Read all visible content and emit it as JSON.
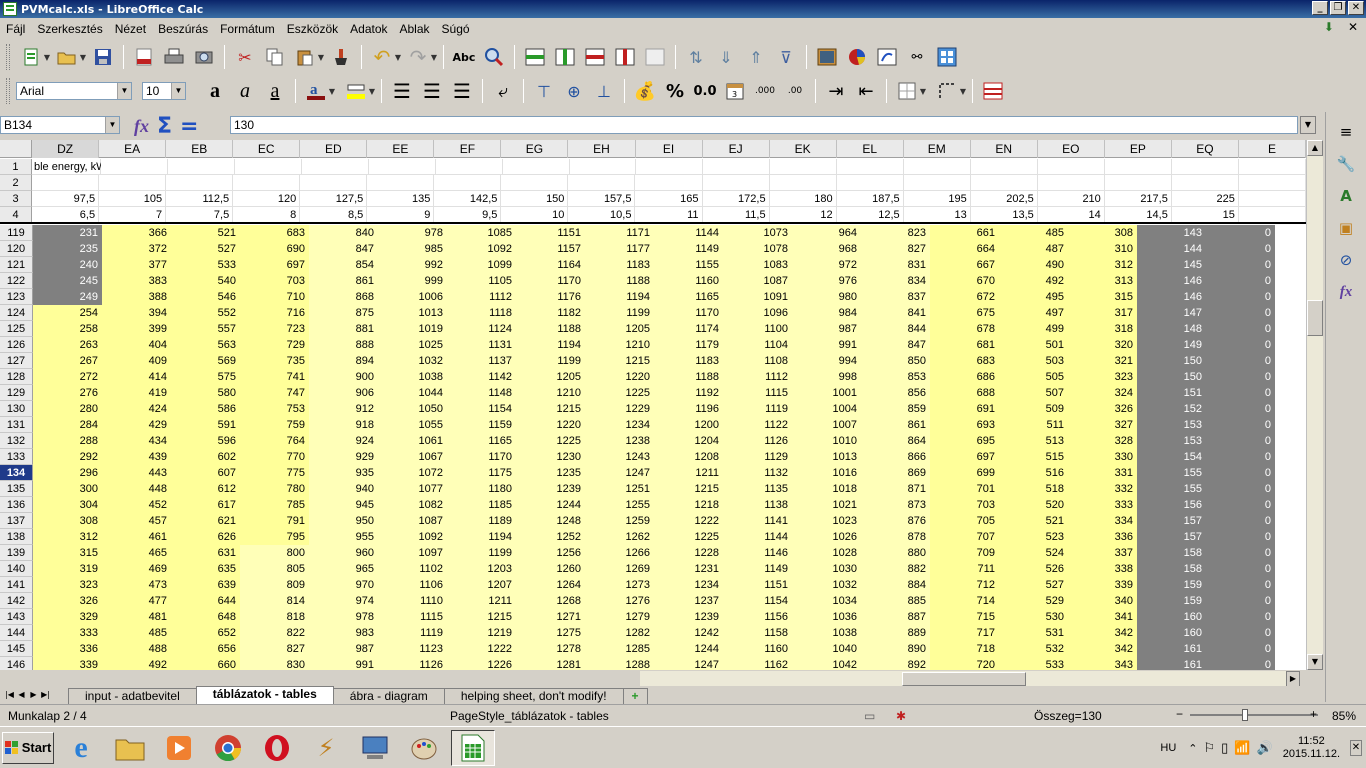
{
  "window": {
    "title": "PVMcalc.xls - LibreOffice Calc"
  },
  "menu": [
    "Fájl",
    "Szerkesztés",
    "Nézet",
    "Beszúrás",
    "Formátum",
    "Eszközök",
    "Adatok",
    "Ablak",
    "Súgó"
  ],
  "font": {
    "name": "Arial",
    "size": "10"
  },
  "formula_bar": {
    "cell_ref": "B134",
    "content": "130"
  },
  "columns": [
    "DZ",
    "EA",
    "EB",
    "EC",
    "ED",
    "EE",
    "EF",
    "EG",
    "EH",
    "EI",
    "EJ",
    "EK",
    "EL",
    "EM",
    "EN",
    "EO",
    "EP",
    "EQ",
    "E"
  ],
  "header_rows": [
    {
      "num": "1",
      "cells": [
        "ble energy, kWh/a",
        "",
        "",
        "",
        "",
        "",
        "",
        "",
        "",
        "",
        "",
        "",
        "",
        "",
        "",
        "",
        "",
        "",
        ""
      ]
    },
    {
      "num": "2",
      "cells": [
        "",
        "",
        "",
        "",
        "",
        "",
        "",
        "",
        "",
        "",
        "",
        "",
        "",
        "",
        "",
        "",
        "",
        "",
        ""
      ]
    },
    {
      "num": "3",
      "cells": [
        "97,5",
        "105",
        "112,5",
        "120",
        "127,5",
        "135",
        "142,5",
        "150",
        "157,5",
        "165",
        "172,5",
        "180",
        "187,5",
        "195",
        "202,5",
        "210",
        "217,5",
        "225",
        ""
      ]
    },
    {
      "num": "4",
      "cells": [
        "6,5",
        "7",
        "7,5",
        "8",
        "8,5",
        "9",
        "9,5",
        "10",
        "10,5",
        "11",
        "11,5",
        "12",
        "12,5",
        "13",
        "13,5",
        "14",
        "14,5",
        "15",
        ""
      ]
    }
  ],
  "rows": [
    {
      "num": "119",
      "cells": [
        "231",
        "366",
        "521",
        "683",
        "840",
        "978",
        "1085",
        "1151",
        "1171",
        "1144",
        "1073",
        "964",
        "823",
        "661",
        "485",
        "308",
        "143",
        "0"
      ]
    },
    {
      "num": "120",
      "cells": [
        "235",
        "372",
        "527",
        "690",
        "847",
        "985",
        "1092",
        "1157",
        "1177",
        "1149",
        "1078",
        "968",
        "827",
        "664",
        "487",
        "310",
        "144",
        "0"
      ]
    },
    {
      "num": "121",
      "cells": [
        "240",
        "377",
        "533",
        "697",
        "854",
        "992",
        "1099",
        "1164",
        "1183",
        "1155",
        "1083",
        "972",
        "831",
        "667",
        "490",
        "312",
        "145",
        "0"
      ]
    },
    {
      "num": "122",
      "cells": [
        "245",
        "383",
        "540",
        "703",
        "861",
        "999",
        "1105",
        "1170",
        "1188",
        "1160",
        "1087",
        "976",
        "834",
        "670",
        "492",
        "313",
        "146",
        "0"
      ]
    },
    {
      "num": "123",
      "cells": [
        "249",
        "388",
        "546",
        "710",
        "868",
        "1006",
        "1112",
        "1176",
        "1194",
        "1165",
        "1091",
        "980",
        "837",
        "672",
        "495",
        "315",
        "146",
        "0"
      ]
    },
    {
      "num": "124",
      "cells": [
        "254",
        "394",
        "552",
        "716",
        "875",
        "1013",
        "1118",
        "1182",
        "1199",
        "1170",
        "1096",
        "984",
        "841",
        "675",
        "497",
        "317",
        "147",
        "0"
      ]
    },
    {
      "num": "125",
      "cells": [
        "258",
        "399",
        "557",
        "723",
        "881",
        "1019",
        "1124",
        "1188",
        "1205",
        "1174",
        "1100",
        "987",
        "844",
        "678",
        "499",
        "318",
        "148",
        "0"
      ]
    },
    {
      "num": "126",
      "cells": [
        "263",
        "404",
        "563",
        "729",
        "888",
        "1025",
        "1131",
        "1194",
        "1210",
        "1179",
        "1104",
        "991",
        "847",
        "681",
        "501",
        "320",
        "149",
        "0"
      ]
    },
    {
      "num": "127",
      "cells": [
        "267",
        "409",
        "569",
        "735",
        "894",
        "1032",
        "1137",
        "1199",
        "1215",
        "1183",
        "1108",
        "994",
        "850",
        "683",
        "503",
        "321",
        "150",
        "0"
      ]
    },
    {
      "num": "128",
      "cells": [
        "272",
        "414",
        "575",
        "741",
        "900",
        "1038",
        "1142",
        "1205",
        "1220",
        "1188",
        "1112",
        "998",
        "853",
        "686",
        "505",
        "323",
        "150",
        "0"
      ]
    },
    {
      "num": "129",
      "cells": [
        "276",
        "419",
        "580",
        "747",
        "906",
        "1044",
        "1148",
        "1210",
        "1225",
        "1192",
        "1115",
        "1001",
        "856",
        "688",
        "507",
        "324",
        "151",
        "0"
      ]
    },
    {
      "num": "130",
      "cells": [
        "280",
        "424",
        "586",
        "753",
        "912",
        "1050",
        "1154",
        "1215",
        "1229",
        "1196",
        "1119",
        "1004",
        "859",
        "691",
        "509",
        "326",
        "152",
        "0"
      ]
    },
    {
      "num": "131",
      "cells": [
        "284",
        "429",
        "591",
        "759",
        "918",
        "1055",
        "1159",
        "1220",
        "1234",
        "1200",
        "1122",
        "1007",
        "861",
        "693",
        "511",
        "327",
        "153",
        "0"
      ]
    },
    {
      "num": "132",
      "cells": [
        "288",
        "434",
        "596",
        "764",
        "924",
        "1061",
        "1165",
        "1225",
        "1238",
        "1204",
        "1126",
        "1010",
        "864",
        "695",
        "513",
        "328",
        "153",
        "0"
      ]
    },
    {
      "num": "133",
      "cells": [
        "292",
        "439",
        "602",
        "770",
        "929",
        "1067",
        "1170",
        "1230",
        "1243",
        "1208",
        "1129",
        "1013",
        "866",
        "697",
        "515",
        "330",
        "154",
        "0"
      ]
    },
    {
      "num": "134",
      "cells": [
        "296",
        "443",
        "607",
        "775",
        "935",
        "1072",
        "1175",
        "1235",
        "1247",
        "1211",
        "1132",
        "1016",
        "869",
        "699",
        "516",
        "331",
        "155",
        "0"
      ]
    },
    {
      "num": "135",
      "cells": [
        "300",
        "448",
        "612",
        "780",
        "940",
        "1077",
        "1180",
        "1239",
        "1251",
        "1215",
        "1135",
        "1018",
        "871",
        "701",
        "518",
        "332",
        "155",
        "0"
      ]
    },
    {
      "num": "136",
      "cells": [
        "304",
        "452",
        "617",
        "785",
        "945",
        "1082",
        "1185",
        "1244",
        "1255",
        "1218",
        "1138",
        "1021",
        "873",
        "703",
        "520",
        "333",
        "156",
        "0"
      ]
    },
    {
      "num": "137",
      "cells": [
        "308",
        "457",
        "621",
        "791",
        "950",
        "1087",
        "1189",
        "1248",
        "1259",
        "1222",
        "1141",
        "1023",
        "876",
        "705",
        "521",
        "334",
        "157",
        "0"
      ]
    },
    {
      "num": "138",
      "cells": [
        "312",
        "461",
        "626",
        "795",
        "955",
        "1092",
        "1194",
        "1252",
        "1262",
        "1225",
        "1144",
        "1026",
        "878",
        "707",
        "523",
        "336",
        "157",
        "0"
      ]
    },
    {
      "num": "139",
      "cells": [
        "315",
        "465",
        "631",
        "800",
        "960",
        "1097",
        "1199",
        "1256",
        "1266",
        "1228",
        "1146",
        "1028",
        "880",
        "709",
        "524",
        "337",
        "158",
        "0"
      ]
    },
    {
      "num": "140",
      "cells": [
        "319",
        "469",
        "635",
        "805",
        "965",
        "1102",
        "1203",
        "1260",
        "1269",
        "1231",
        "1149",
        "1030",
        "882",
        "711",
        "526",
        "338",
        "158",
        "0"
      ]
    },
    {
      "num": "141",
      "cells": [
        "323",
        "473",
        "639",
        "809",
        "970",
        "1106",
        "1207",
        "1264",
        "1273",
        "1234",
        "1151",
        "1032",
        "884",
        "712",
        "527",
        "339",
        "159",
        "0"
      ]
    },
    {
      "num": "142",
      "cells": [
        "326",
        "477",
        "644",
        "814",
        "974",
        "1110",
        "1211",
        "1268",
        "1276",
        "1237",
        "1154",
        "1034",
        "885",
        "714",
        "529",
        "340",
        "159",
        "0"
      ]
    },
    {
      "num": "143",
      "cells": [
        "329",
        "481",
        "648",
        "818",
        "978",
        "1115",
        "1215",
        "1271",
        "1279",
        "1239",
        "1156",
        "1036",
        "887",
        "715",
        "530",
        "341",
        "160",
        "0"
      ]
    },
    {
      "num": "144",
      "cells": [
        "333",
        "485",
        "652",
        "822",
        "983",
        "1119",
        "1219",
        "1275",
        "1282",
        "1242",
        "1158",
        "1038",
        "889",
        "717",
        "531",
        "342",
        "160",
        "0"
      ]
    },
    {
      "num": "145",
      "cells": [
        "336",
        "488",
        "656",
        "827",
        "987",
        "1123",
        "1222",
        "1278",
        "1285",
        "1244",
        "1160",
        "1040",
        "890",
        "718",
        "532",
        "342",
        "161",
        "0"
      ]
    },
    {
      "num": "146",
      "cells": [
        "339",
        "492",
        "660",
        "830",
        "991",
        "1126",
        "1226",
        "1281",
        "1288",
        "1247",
        "1162",
        "1042",
        "892",
        "720",
        "533",
        "343",
        "161",
        "0"
      ]
    }
  ],
  "tabs": [
    {
      "label": "input - adatbevitel",
      "active": false
    },
    {
      "label": "táblázatok - tables",
      "active": true
    },
    {
      "label": "ábra - diagram",
      "active": false
    },
    {
      "label": "helping sheet, don't modify!",
      "active": false
    }
  ],
  "status": {
    "sheet": "Munkalap 2 / 4",
    "page_style": "PageStyle_táblázatok - tables",
    "sum": "Összeg=130",
    "zoom": "85%"
  },
  "taskbar": {
    "start": "Start",
    "lang": "HU",
    "time": "11:52",
    "date": "2015.11.12."
  }
}
